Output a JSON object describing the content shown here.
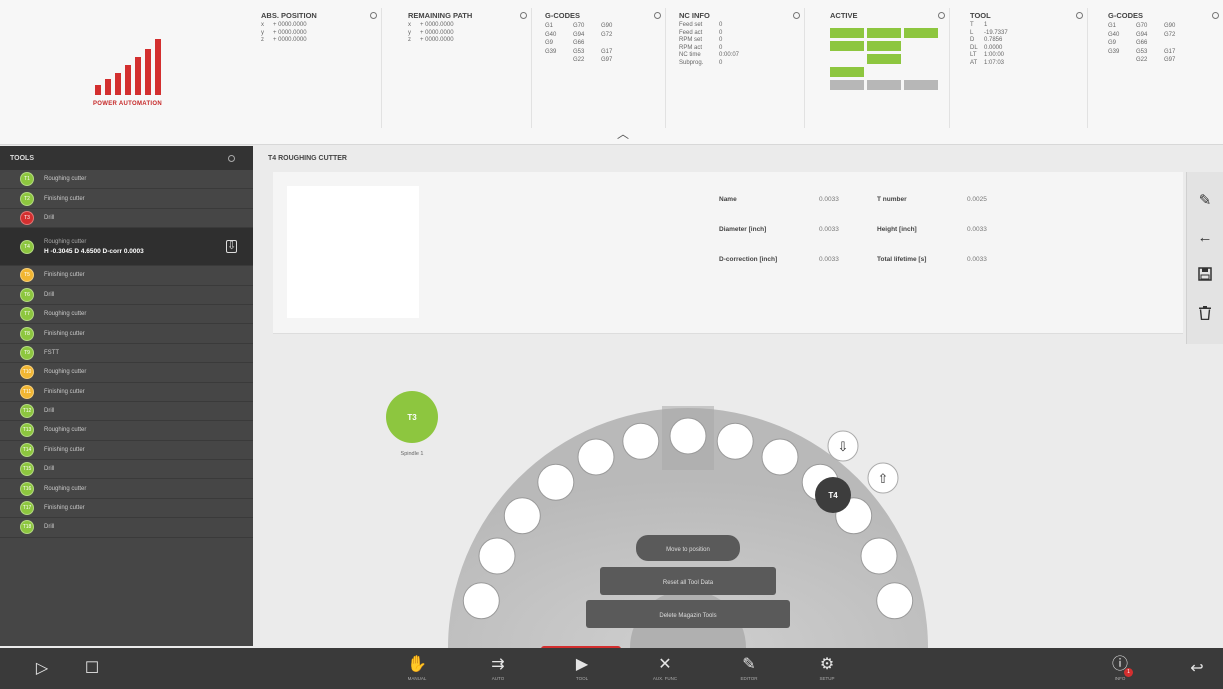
{
  "brand": {
    "logo_text": "POWER AUTOMATION",
    "accent": "#d32f2f"
  },
  "top": {
    "abs_position": {
      "title": "ABS. POSITION",
      "rows": [
        {
          "axis": "x",
          "value": "+ 0000.0000"
        },
        {
          "axis": "y",
          "value": "+ 0000.0000"
        },
        {
          "axis": "z",
          "value": "+ 0000.0000"
        }
      ]
    },
    "remaining_path": {
      "title": "REMAINING PATH",
      "rows": [
        {
          "axis": "x",
          "value": "+ 0000.0000"
        },
        {
          "axis": "y",
          "value": "+ 0000.0000"
        },
        {
          "axis": "z",
          "value": "+ 0000.0000"
        }
      ]
    },
    "gcodes_1": {
      "title": "G-CODES",
      "cells": [
        "G1",
        "G70",
        "G90",
        "G40",
        "G94",
        "G72",
        "G9",
        "G66",
        "",
        "G39",
        "G53",
        "G17",
        "",
        "G22",
        "G97"
      ]
    },
    "nc_info": {
      "title": "NC INFO",
      "rows": [
        {
          "k": "Feed set",
          "v": "0"
        },
        {
          "k": "Feed act",
          "v": "0"
        },
        {
          "k": "RPM set",
          "v": "0"
        },
        {
          "k": "RPM act",
          "v": "0"
        },
        {
          "k": "NC time",
          "v": "0:00:07"
        },
        {
          "k": "Subprog.",
          "v": "0"
        }
      ]
    },
    "active": {
      "title": "ACTIVE"
    },
    "tool": {
      "title": "TOOL",
      "rows": [
        {
          "k": "T",
          "v": "1"
        },
        {
          "k": "L",
          "v": "-19.7337"
        },
        {
          "k": "D",
          "v": "0.7856"
        },
        {
          "k": "DL",
          "v": "0.0000"
        },
        {
          "k": "LT",
          "v": "1:00:00"
        },
        {
          "k": "AT",
          "v": "1:07:03"
        }
      ]
    },
    "gcodes_2": {
      "title": "G-CODES",
      "cells": [
        "G1",
        "G70",
        "G90",
        "G40",
        "G94",
        "G72",
        "G9",
        "G66",
        "",
        "G39",
        "G53",
        "G17",
        "",
        "G22",
        "G97"
      ]
    }
  },
  "sidebar": {
    "title": "TOOLS",
    "items": [
      {
        "num": "T1",
        "label": "Roughing cutter",
        "color": "#8dc63f"
      },
      {
        "num": "T2",
        "label": "Finishing cutter",
        "color": "#8dc63f"
      },
      {
        "num": "T3",
        "label": "Drill",
        "color": "#d32f2f"
      },
      {
        "num": "T4",
        "label": "Roughing cutter",
        "color": "#8dc63f",
        "selected": true,
        "details": "H -0.3045  D 4.6500  D-corr 0.0003"
      },
      {
        "num": "T5",
        "label": "Finishing cutter",
        "color": "#f2b632"
      },
      {
        "num": "T6",
        "label": "Drill",
        "color": "#8dc63f"
      },
      {
        "num": "T7",
        "label": "Roughing cutter",
        "color": "#8dc63f"
      },
      {
        "num": "T8",
        "label": "Finishing cutter",
        "color": "#8dc63f"
      },
      {
        "num": "T9",
        "label": "FSTT",
        "color": "#8dc63f"
      },
      {
        "num": "T10",
        "label": "Roughing cutter",
        "color": "#f2b632"
      },
      {
        "num": "T11",
        "label": "Finishing cutter",
        "color": "#f2b632"
      },
      {
        "num": "T12",
        "label": "Drill",
        "color": "#8dc63f"
      },
      {
        "num": "T13",
        "label": "Roughing cutter",
        "color": "#8dc63f"
      },
      {
        "num": "T14",
        "label": "Finishing cutter",
        "color": "#8dc63f"
      },
      {
        "num": "T15",
        "label": "Drill",
        "color": "#8dc63f"
      },
      {
        "num": "T16",
        "label": "Roughing cutter",
        "color": "#8dc63f"
      },
      {
        "num": "T17",
        "label": "Finishing cutter",
        "color": "#8dc63f"
      },
      {
        "num": "T18",
        "label": "Drill",
        "color": "#8dc63f"
      }
    ]
  },
  "main": {
    "title": "T4 ROUGHING CUTTER",
    "fields": {
      "name": {
        "label": "Name",
        "value": "0.0033"
      },
      "t_number": {
        "label": "T number",
        "value": "0.0025"
      },
      "diameter": {
        "label": "Diameter [inch]",
        "value": "0.0033"
      },
      "height": {
        "label": "Height [inch]",
        "value": "0.0033"
      },
      "d_correction": {
        "label": "D-correction [inch]",
        "value": "0.0033"
      },
      "total_lifetime": {
        "label": "Total lifetime [s]",
        "value": "0.0033"
      }
    }
  },
  "magazine": {
    "spindle": {
      "label": "T3",
      "caption": "Spindle 1"
    },
    "active_tool": "T4",
    "menu": [
      "Move to position",
      "Reset all Tool Data",
      "Delete Magazin Tools"
    ]
  },
  "bottombar": {
    "items": [
      {
        "icon": "hand-icon",
        "label": "MANUAL"
      },
      {
        "icon": "auto-icon",
        "label": "AUTO"
      },
      {
        "icon": "tool-icon",
        "label": "TOOL"
      },
      {
        "icon": "wrench-icon",
        "label": "AUX. FUNC"
      },
      {
        "icon": "editor-icon",
        "label": "EDITOR"
      },
      {
        "icon": "gear-icon",
        "label": "SETUP"
      }
    ],
    "info_label": "INFO",
    "info_badge": "1"
  }
}
